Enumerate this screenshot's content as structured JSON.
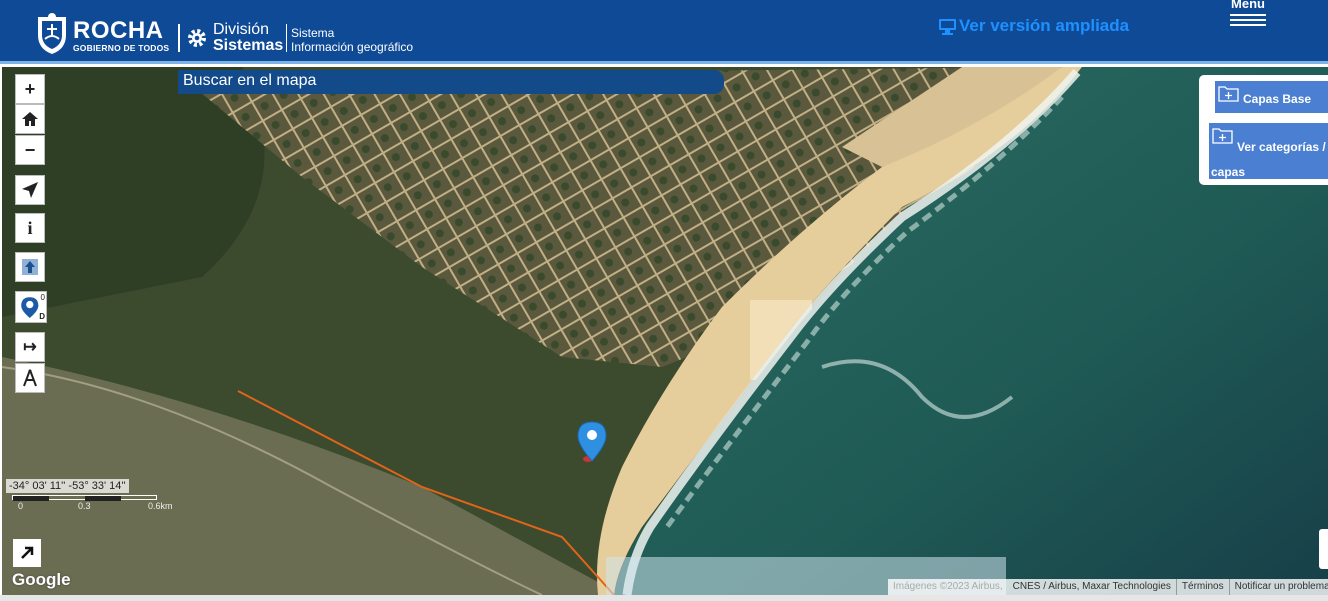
{
  "header": {
    "brand_title": "ROCHA",
    "brand_subtitle": "GOBIERNO DE TODOS",
    "division_line1": "División",
    "division_line2": "Sistemas",
    "system_line1": "Sistema",
    "system_line2": "Información geográfico",
    "expanded_view_label": "Ver versión ampliada",
    "menu_label": "Menu",
    "colors": {
      "bar": "#0f4a97",
      "link": "#1e90ff"
    }
  },
  "map": {
    "search_placeholder": "Buscar en el mapa",
    "tools": [
      {
        "label": "+",
        "icon": "zoom-in-icon"
      },
      {
        "label": "",
        "icon": "home-icon"
      },
      {
        "label": "−",
        "icon": "zoom-out-icon"
      },
      {
        "label": "",
        "icon": "locate-arrow-icon"
      },
      {
        "label": "i",
        "icon": "info-icon"
      },
      {
        "label": "",
        "icon": "upload-icon"
      },
      {
        "label": "",
        "icon": "gps-marker-icon"
      },
      {
        "label": "↦",
        "icon": "measure-distance-icon"
      },
      {
        "label": "",
        "icon": "compass-draw-icon"
      }
    ],
    "gps_badge_top": "0",
    "gps_badge_bottom": "D",
    "layers": {
      "base_label": "Capas Base",
      "categories_label": "Ver categorías / capas"
    },
    "coordinates": "-34° 03' 11'' -53° 33' 14''",
    "scale_labels": [
      "0",
      "0.3",
      "0.6km"
    ],
    "google_label": "Google",
    "attribution": {
      "imagery": "Imágenes ©2023 Airbus,",
      "providers": "CNES / Airbus, Maxar Technologies",
      "terms": "Términos",
      "report": "Notificar un problema c"
    },
    "marker_color": "#2f8fe0"
  }
}
